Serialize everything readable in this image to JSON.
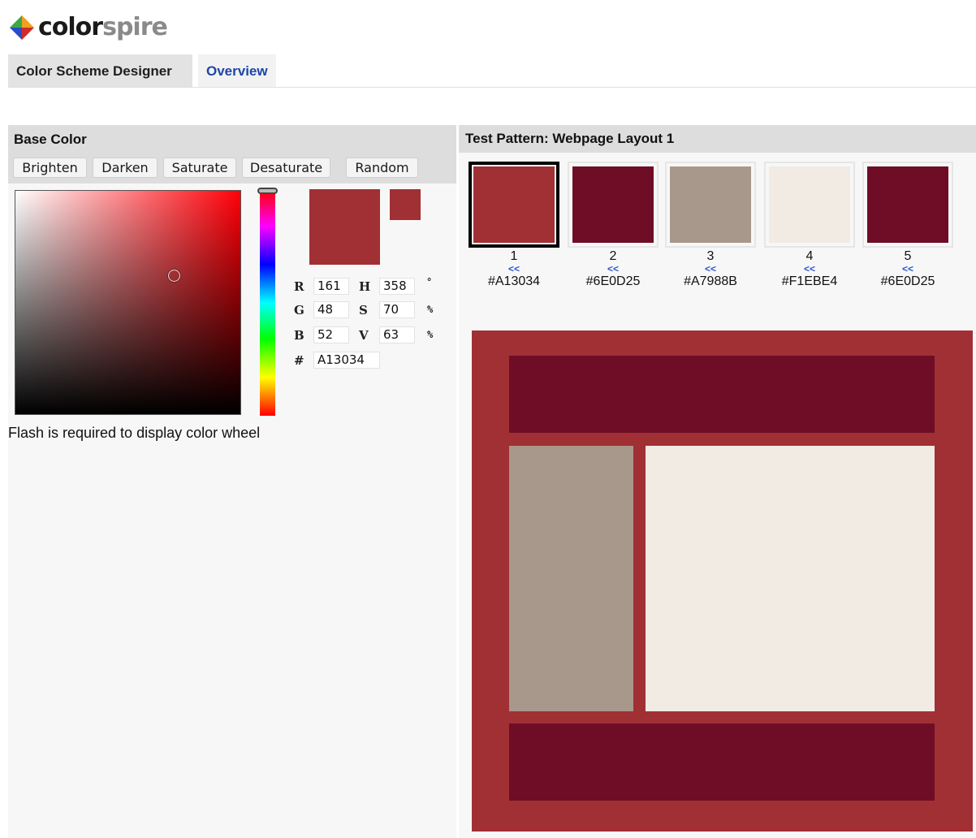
{
  "logo": {
    "part1": "color",
    "part2": "spire"
  },
  "tabs": [
    {
      "label": "Color Scheme Designer"
    },
    {
      "label": "Overview"
    }
  ],
  "base_color": {
    "title": "Base Color",
    "buttons": [
      "Brighten",
      "Darken",
      "Saturate",
      "Desaturate",
      "Random"
    ],
    "rgb": {
      "r_label": "R",
      "r": "161",
      "g_label": "G",
      "g": "48",
      "b_label": "B",
      "b": "52"
    },
    "hsv": {
      "h_label": "H",
      "h": "358",
      "h_unit": "°",
      "s_label": "S",
      "s": "70",
      "s_unit": "%",
      "v_label": "V",
      "v": "63",
      "v_unit": "%"
    },
    "hex_label": "#",
    "hex": "A13034",
    "flash_note": "Flash is required to display color wheel"
  },
  "test_pattern": {
    "title": "Test Pattern: Webpage Layout 1",
    "swatches": [
      {
        "num": "1",
        "arrow": "<<",
        "hex": "#A13034",
        "color": "#A13034"
      },
      {
        "num": "2",
        "arrow": "<<",
        "hex": "#6E0D25",
        "color": "#6E0D25"
      },
      {
        "num": "3",
        "arrow": "<<",
        "hex": "#A7988B",
        "color": "#A7988B"
      },
      {
        "num": "4",
        "arrow": "<<",
        "hex": "#F1EBE4",
        "color": "#F1EBE4"
      },
      {
        "num": "5",
        "arrow": "<<",
        "hex": "#6E0D25",
        "color": "#6E0D25"
      }
    ]
  },
  "colors": {
    "base": "#A13034",
    "header": "#6E0D25",
    "sidebar": "#A7988B",
    "content": "#F1EBE4",
    "footer": "#6E0D25",
    "link": "#1e46a7"
  }
}
